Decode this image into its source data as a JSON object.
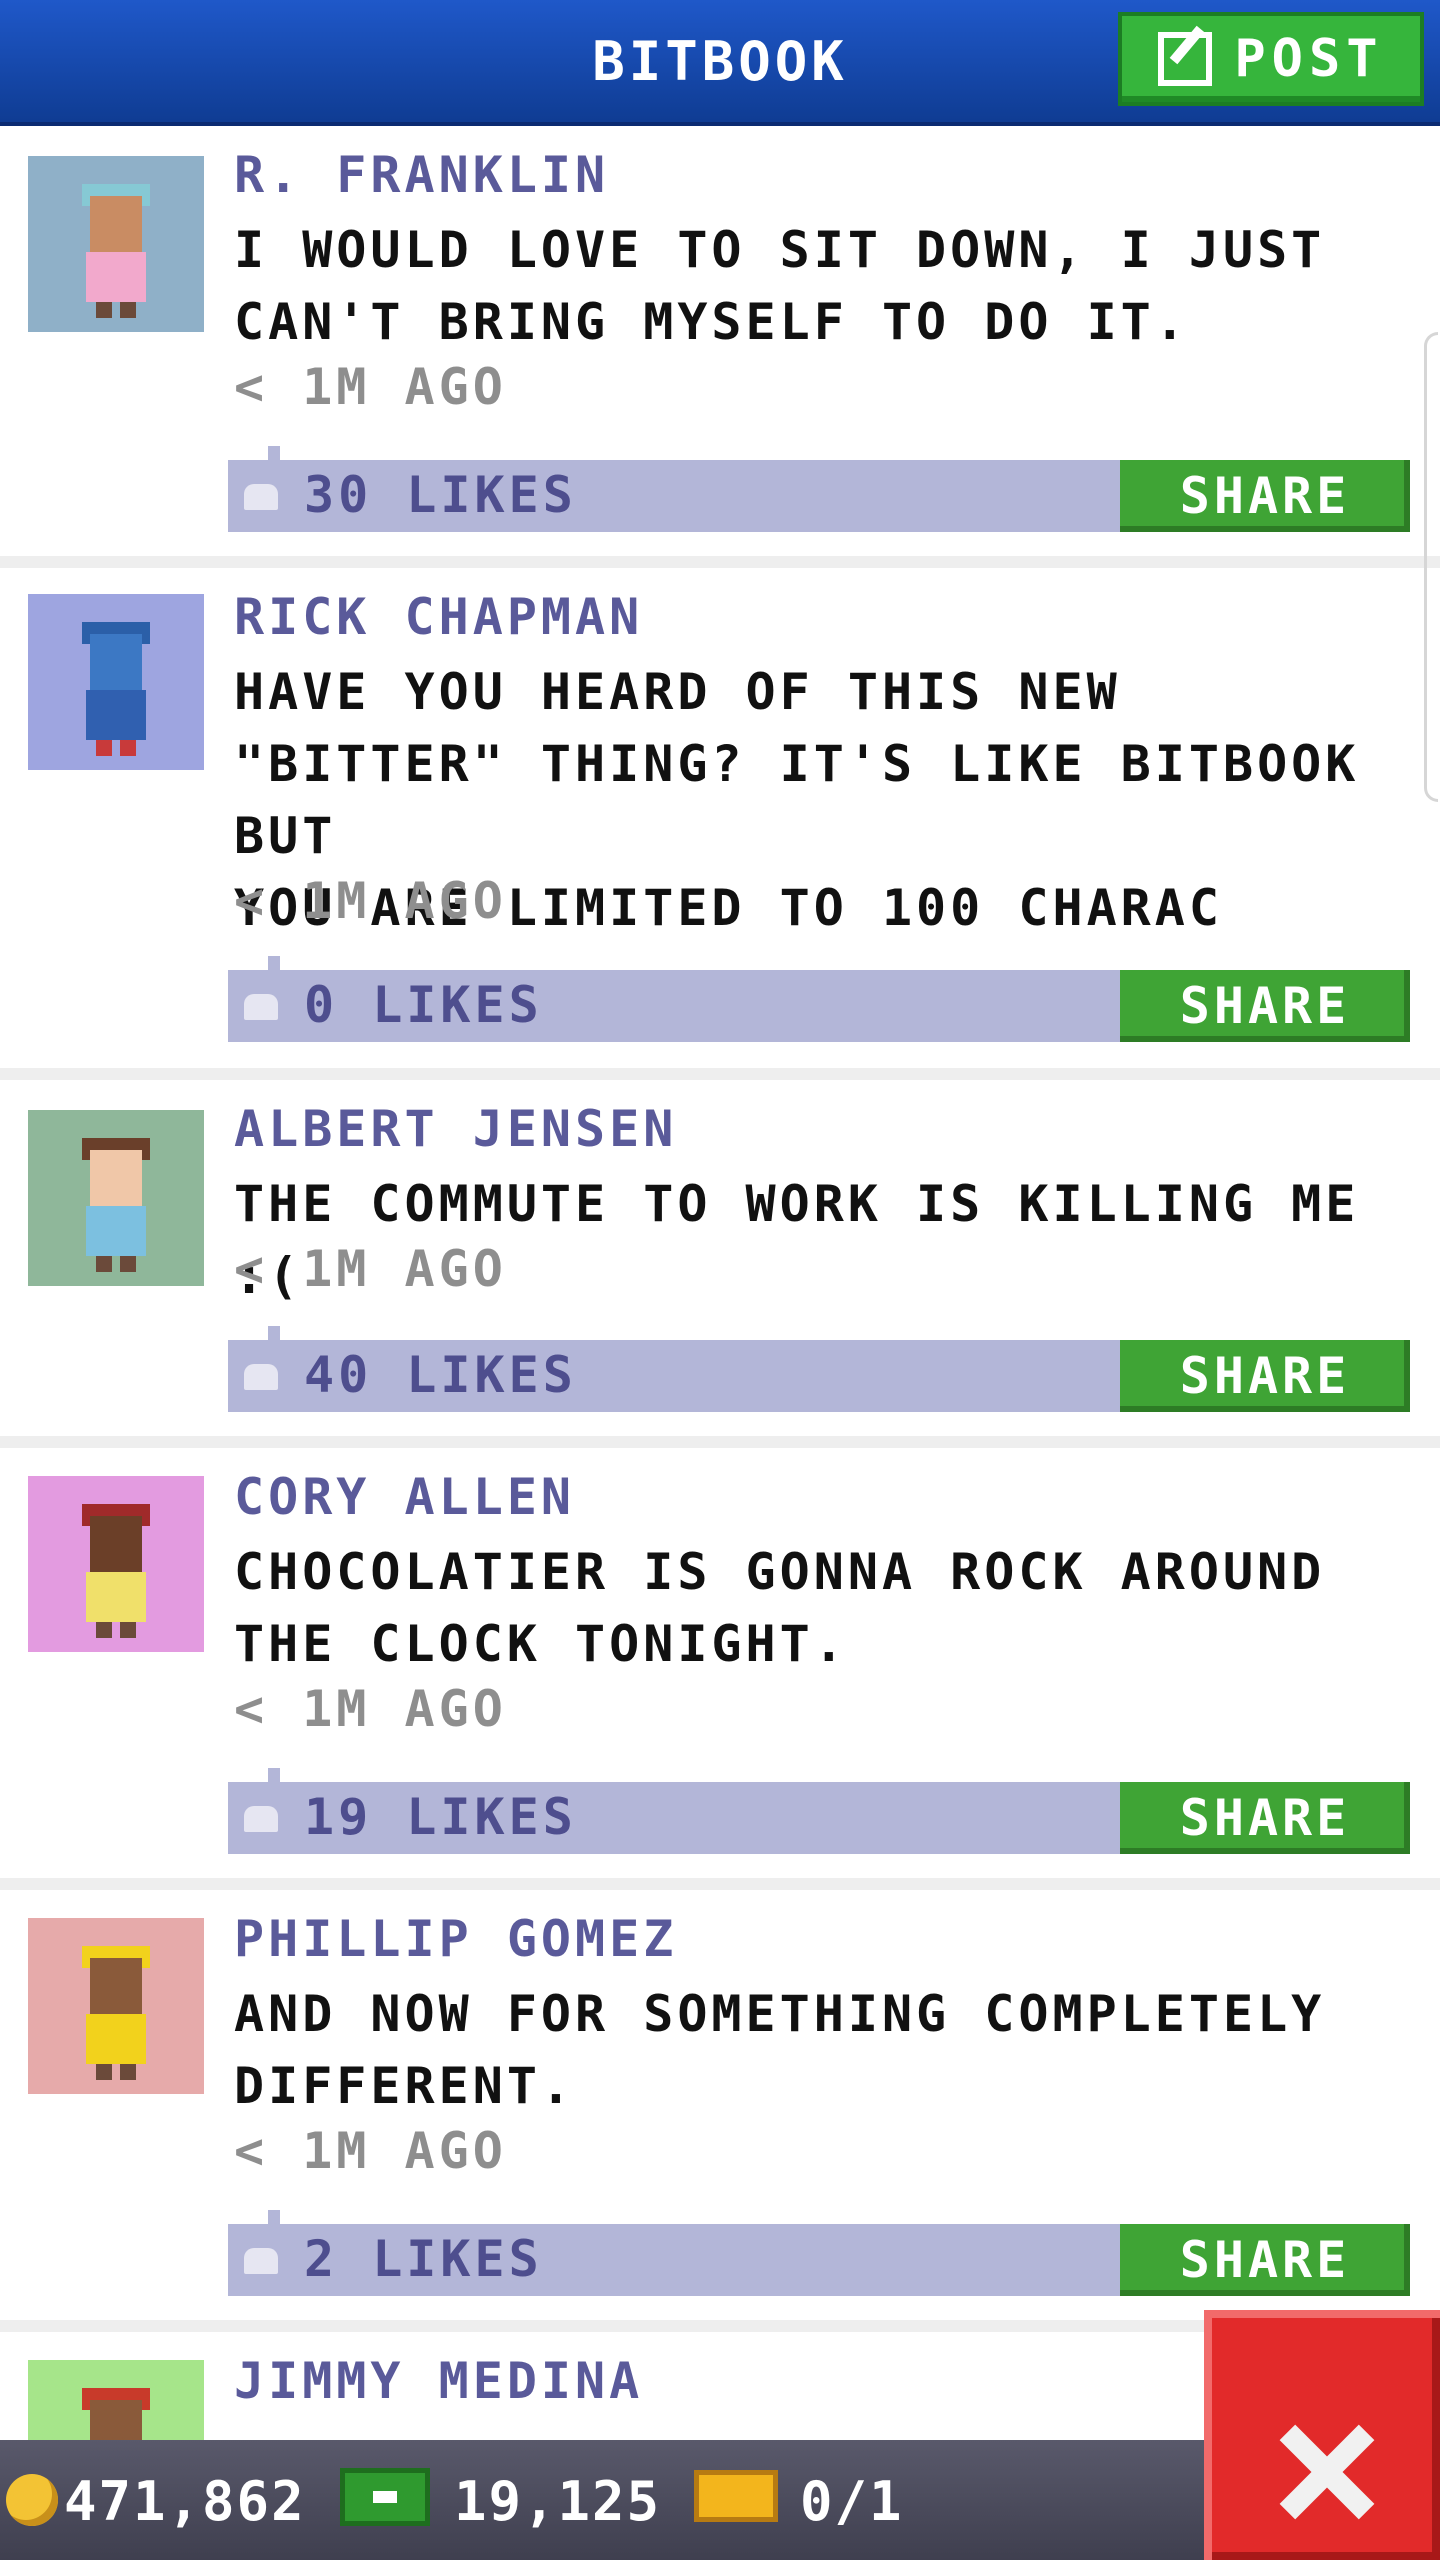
{
  "header": {
    "title": "BITBOOK",
    "post_label": "POST"
  },
  "posts": [
    {
      "author": "R. FRANKLIN",
      "message": "I WOULD LOVE TO SIT DOWN, I JUST\nCAN'T BRING MYSELF TO DO IT.",
      "time": "< 1M AGO",
      "likes": "30 LIKES",
      "share": "SHARE",
      "avatar_bg": "#8fb0c8"
    },
    {
      "author": "RICK CHAPMAN",
      "message": "HAVE YOU HEARD OF THIS NEW\n\"BITTER\" THING? IT'S LIKE BITBOOK BUT\nYOU ARE LIMITED TO 100 CHARAC",
      "time": "< 1M AGO",
      "likes": "0 LIKES",
      "share": "SHARE",
      "avatar_bg": "#9ea5e0"
    },
    {
      "author": "ALBERT JENSEN",
      "message": "THE COMMUTE TO WORK IS KILLING ME :(",
      "time": "< 1M AGO",
      "likes": "40 LIKES",
      "share": "SHARE",
      "avatar_bg": "#8fb79a"
    },
    {
      "author": "CORY ALLEN",
      "message": "CHOCOLATIER IS GONNA ROCK AROUND\nTHE CLOCK TONIGHT.",
      "time": "< 1M AGO",
      "likes": "19 LIKES",
      "share": "SHARE",
      "avatar_bg": "#e39be0"
    },
    {
      "author": "PHILLIP GOMEZ",
      "message": "AND NOW FOR SOMETHING COMPLETELY\nDIFFERENT.",
      "time": "< 1M AGO",
      "likes": "2 LIKES",
      "share": "SHARE",
      "avatar_bg": "#e6aaaa"
    },
    {
      "author": "JIMMY MEDINA",
      "avatar_bg": "#a6e58a"
    }
  ],
  "status": {
    "coins": "471,862",
    "bux": "19,125",
    "tickets": "0/1"
  },
  "colors": {
    "header": "#1a4fb5",
    "accent_green": "#3fa435",
    "like_bar": "#b3b6d8",
    "close_red": "#e22a2a"
  },
  "icons": {
    "post": "compose-icon",
    "like": "thumbs-up-icon",
    "coin": "coin-icon",
    "bux": "bux-icon",
    "ticket": "ticket-icon",
    "close": "close-icon"
  }
}
